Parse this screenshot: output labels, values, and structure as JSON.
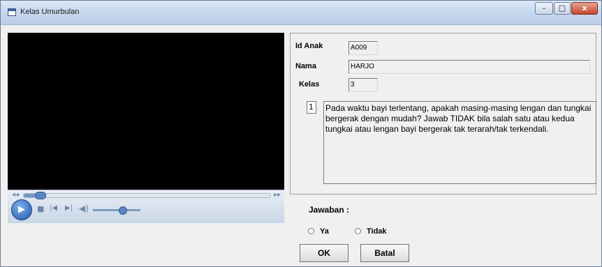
{
  "window": {
    "title": "Kelas Umurbulan",
    "controls": {
      "minimize": "–",
      "maximize": "□",
      "close": "x"
    }
  },
  "player": {
    "progress_fraction": 0.05,
    "volume_fraction": 0.55
  },
  "form": {
    "id_anak": {
      "label": "Id Anak",
      "value": "A009"
    },
    "nama": {
      "label": "Nama",
      "value": "HARJO"
    },
    "kelas": {
      "label": "Kelas",
      "value": "3"
    },
    "question": {
      "number": "1",
      "text": "Pada waktu bayi terlentang, apakah masing-masing lengan dan tungkai bergerak dengan mudah? Jawab TIDAK bila salah satu atau kedua tungkai atau lengan bayi bergerak tak terarah/tak terkendali."
    },
    "jawaban_label": "Jawaban :",
    "options": {
      "ya": "Ya",
      "tidak": "Tidak"
    },
    "buttons": {
      "ok": "OK",
      "batal": "Batal"
    }
  }
}
